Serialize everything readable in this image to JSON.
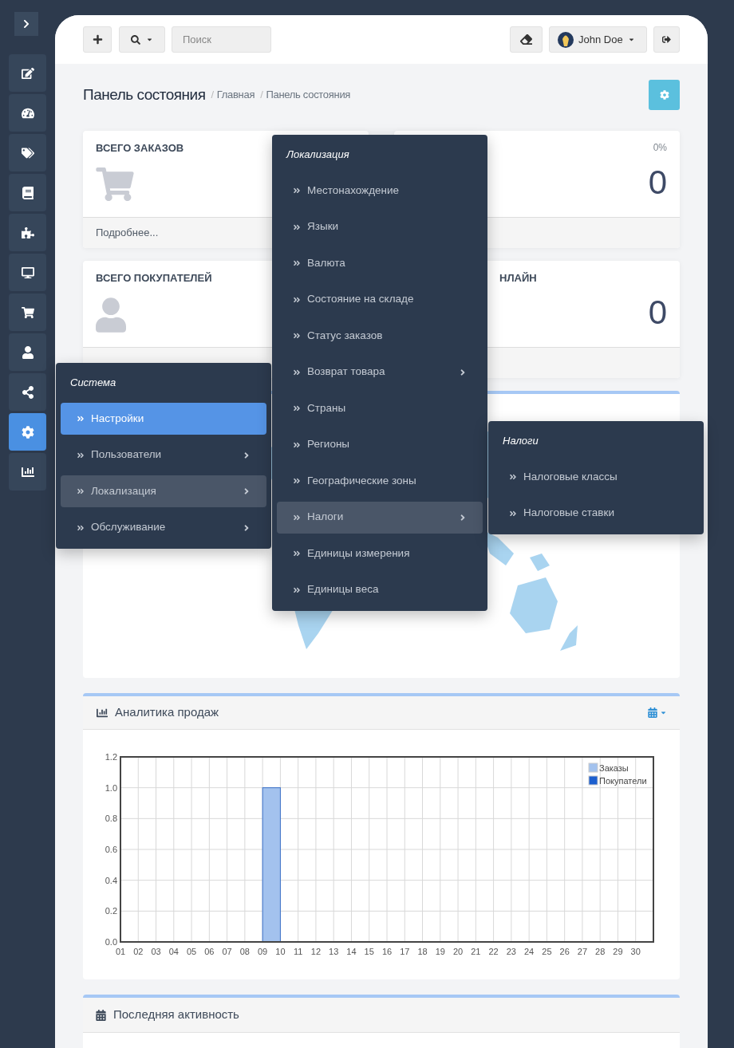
{
  "sidebar": {
    "items": [
      {
        "selected": false
      },
      {
        "selected": false
      },
      {
        "selected": false
      },
      {
        "selected": false
      },
      {
        "selected": false
      },
      {
        "selected": false
      },
      {
        "selected": false
      },
      {
        "selected": false
      },
      {
        "selected": false
      },
      {
        "selected": true
      },
      {
        "selected": false
      }
    ]
  },
  "header": {
    "search": {
      "placeholder": "Поиск"
    },
    "user": {
      "name": "John Doe"
    }
  },
  "page": {
    "title": "Панель состояния",
    "breadcrumb_separator": "/",
    "breadcrumbs": [
      "Главная",
      "Панель состояния"
    ]
  },
  "tiles": [
    {
      "title": "ВСЕГО ЗАКАЗОВ",
      "kind": "orders",
      "footer": "Подробнее..."
    },
    {
      "percent": "0%",
      "value": "0"
    },
    {
      "title": "ВСЕГО ПОКУПАТЕЛЕЙ",
      "kind": "customers"
    },
    {
      "title": "НЛАЙН",
      "value": "0"
    }
  ],
  "sales_panel": {
    "title": "Аналитика продаж",
    "chart_data": {
      "type": "bar",
      "grid": true,
      "categories": [
        "01",
        "02",
        "03",
        "04",
        "05",
        "06",
        "07",
        "08",
        "09",
        "10",
        "11",
        "12",
        "13",
        "14",
        "15",
        "16",
        "17",
        "18",
        "19",
        "20",
        "21",
        "22",
        "23",
        "24",
        "25",
        "26",
        "27",
        "28",
        "29",
        "30"
      ],
      "series": [
        {
          "name": "Заказы",
          "color": "#a3c2ee",
          "values": [
            0,
            0,
            0,
            0,
            0,
            0,
            0,
            0,
            1,
            0,
            0,
            0,
            0,
            0,
            0,
            0,
            0,
            0,
            0,
            0,
            0,
            0,
            0,
            0,
            0,
            0,
            0,
            0,
            0,
            0
          ]
        },
        {
          "name": "Покупатели",
          "color": "#1c5fcf",
          "values": [
            0,
            0,
            0,
            0,
            0,
            0,
            0,
            0,
            0,
            0,
            0,
            0,
            0,
            0,
            0,
            0,
            0,
            0,
            0,
            0,
            0,
            0,
            0,
            0,
            0,
            0,
            0,
            0,
            0,
            0
          ]
        }
      ],
      "ylim": [
        0,
        1.2
      ],
      "yticks": [
        {
          "value": 0,
          "label": "0.0"
        },
        {
          "value": 0.2,
          "label": "0.2"
        },
        {
          "value": 0.4,
          "label": "0.4"
        },
        {
          "value": 0.6,
          "label": "0.6"
        },
        {
          "value": 0.8,
          "label": "0.8"
        },
        {
          "value": 1,
          "label": "1.0"
        },
        {
          "value": 1.2,
          "label": "1.2"
        }
      ]
    }
  },
  "activity_panel": {
    "title": "Последняя активность"
  },
  "menus": [
    {
      "title": "Система",
      "items": [
        {
          "label": "Настройки",
          "selected": true,
          "open": false,
          "has_submenu": false
        },
        {
          "label": "Пользователи",
          "selected": false,
          "open": false,
          "has_submenu": true
        },
        {
          "label": "Локализация",
          "selected": false,
          "open": true,
          "has_submenu": true
        },
        {
          "label": "Обслуживание",
          "selected": false,
          "open": false,
          "has_submenu": true
        }
      ]
    },
    {
      "title": "Локализация",
      "items": [
        {
          "label": "Местонахождение",
          "selected": false,
          "open": false,
          "has_submenu": false
        },
        {
          "label": "Языки",
          "selected": false,
          "open": false,
          "has_submenu": false
        },
        {
          "label": "Валюта",
          "selected": false,
          "open": false,
          "has_submenu": false
        },
        {
          "label": "Состояние на складе",
          "selected": false,
          "open": false,
          "has_submenu": false
        },
        {
          "label": "Статус заказов",
          "selected": false,
          "open": false,
          "has_submenu": false
        },
        {
          "label": "Возврат товара",
          "selected": false,
          "open": false,
          "has_submenu": true
        },
        {
          "label": "Страны",
          "selected": false,
          "open": false,
          "has_submenu": false
        },
        {
          "label": "Регионы",
          "selected": false,
          "open": false,
          "has_submenu": false
        },
        {
          "label": "Географические зоны",
          "selected": false,
          "open": false,
          "has_submenu": false
        },
        {
          "label": "Налоги",
          "selected": false,
          "open": true,
          "has_submenu": true
        },
        {
          "label": "Единицы измерения",
          "selected": false,
          "open": false,
          "has_submenu": false
        },
        {
          "label": "Единицы веса",
          "selected": false,
          "open": false,
          "has_submenu": false
        }
      ]
    },
    {
      "title": "Налоги",
      "items": [
        {
          "label": "Налоговые классы",
          "selected": false,
          "open": false,
          "has_submenu": false
        },
        {
          "label": "Налоговые ставки",
          "selected": false,
          "open": false,
          "has_submenu": false
        }
      ]
    }
  ]
}
